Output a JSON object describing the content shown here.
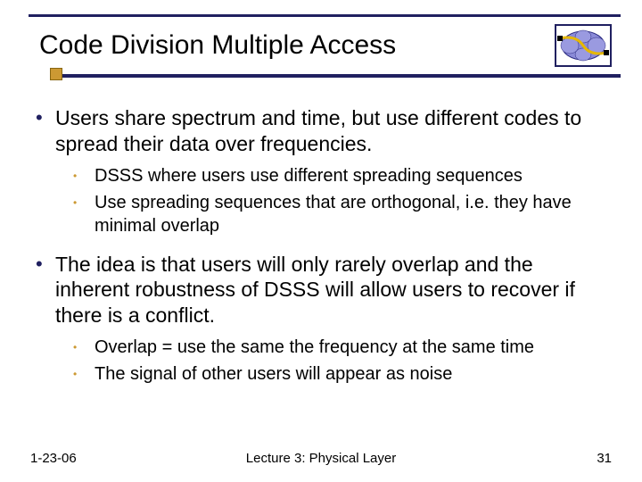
{
  "title": "Code Division Multiple Access",
  "bullets": {
    "b1a": "Users share spectrum and time, but use different codes to spread their data over frequencies.",
    "b1a_sub1": "DSSS where users use different spreading sequences",
    "b1a_sub2": "Use spreading sequences that are orthogonal, i.e. they have minimal overlap",
    "b1b": "The idea is that users will only rarely overlap and the inherent robustness of DSSS will allow users to recover if there is a conflict.",
    "b1b_sub1": "Overlap = use the same the frequency at the same time",
    "b1b_sub2": "The signal of other users will appear as noise"
  },
  "footer": {
    "date": "1-23-06",
    "lecture": "Lecture 3: Physical Layer",
    "page": "31"
  }
}
